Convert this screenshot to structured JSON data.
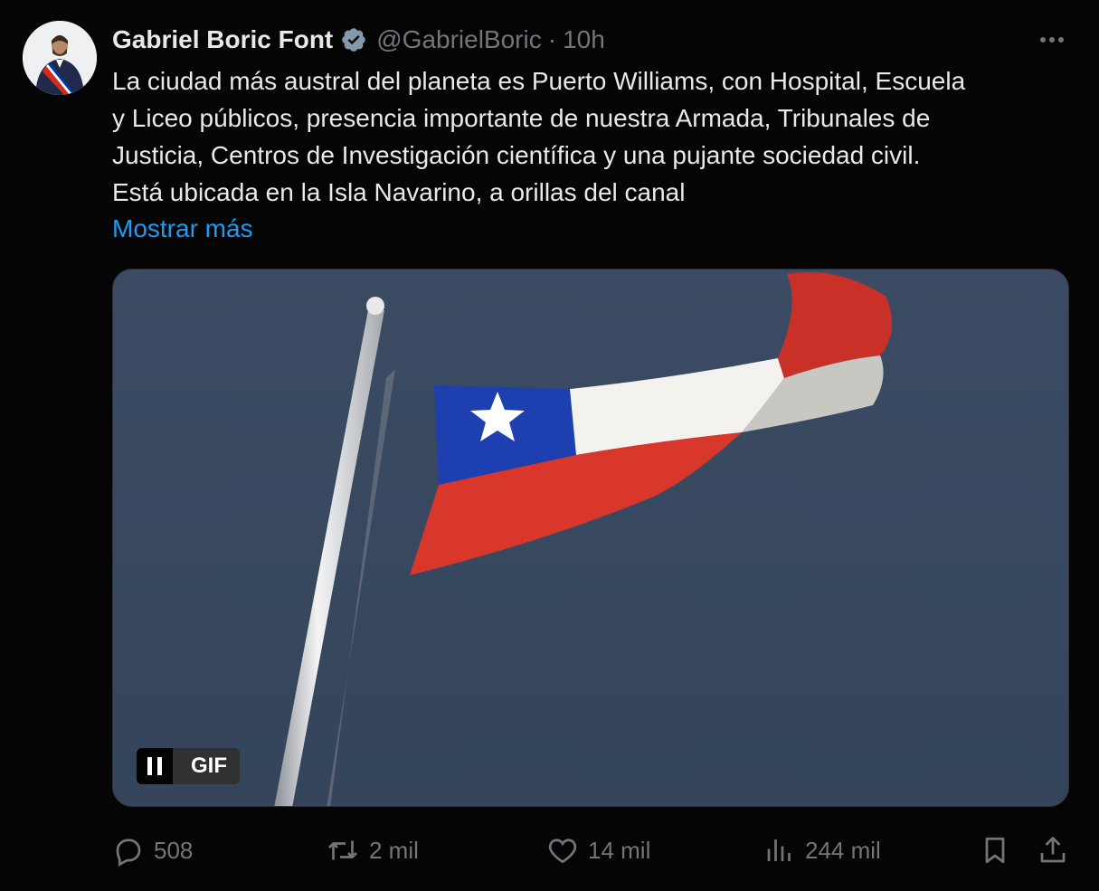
{
  "author": {
    "name": "Gabriel Boric Font",
    "handle": "@GabrielBoric",
    "separator": "·",
    "time": "10h"
  },
  "tweet": {
    "lines": [
      "La ciudad más austral del planeta es Puerto Williams, con Hospital, Escuela",
      "y Liceo públicos, presencia importante de nuestra Armada, Tribunales de",
      "Justicia, Centros de Investigación científica y una pujante sociedad civil.",
      "Está ubicada en la Isla Navarino, a orillas del canal"
    ],
    "show_more": "Mostrar más"
  },
  "media": {
    "badge": "GIF",
    "icon": "pause-icon"
  },
  "actions": {
    "replies": "508",
    "reposts": "2 mil",
    "likes": "14 mil",
    "views": "244 mil"
  },
  "colors": {
    "background": "#050505",
    "text": "#e7e9ea",
    "muted": "#71767b",
    "link": "#1d9bf0",
    "verified": "#829aab",
    "sky": "#36475e"
  }
}
